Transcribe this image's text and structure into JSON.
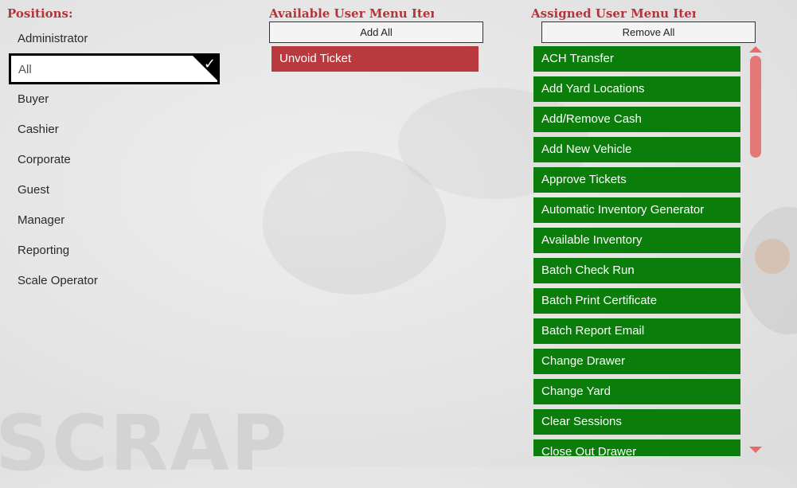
{
  "positions": {
    "title": "Positions:",
    "items": [
      "Administrator",
      "All",
      "Buyer",
      "Cashier",
      "Corporate",
      "Guest",
      "Manager",
      "Reporting",
      "Scale Operator"
    ],
    "selected": "All"
  },
  "available": {
    "title": "Available User Menu Items:",
    "add_all_label": "Add All",
    "items": [
      "Unvoid Ticket"
    ]
  },
  "assigned": {
    "title": "Assigned User Menu Items:",
    "remove_all_label": "Remove All",
    "items": [
      "ACH Transfer",
      "Add Yard Locations",
      "Add/Remove Cash",
      "Add New Vehicle",
      "Approve Tickets",
      "Automatic Inventory Generator",
      "Available Inventory",
      "Batch Check Run",
      "Batch Print Certificate",
      "Batch Report Email",
      "Change Drawer",
      "Change Yard",
      "Clear Sessions",
      "Close Out Drawer"
    ]
  },
  "background": {
    "watermark_text": "SCRAP"
  },
  "colors": {
    "accent": "#b5343a",
    "available_tile": "#b83a3e",
    "assigned_tile": "#0b7d0b",
    "scrollbar": "#e47878"
  }
}
